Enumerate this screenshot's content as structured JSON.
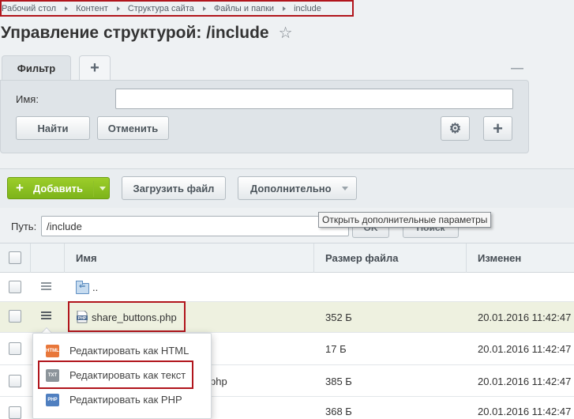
{
  "breadcrumb": [
    "Рабочий стол",
    "Контент",
    "Структура сайта",
    "Файлы и папки",
    "include"
  ],
  "page": {
    "title": "Управление структурой: /include"
  },
  "filter": {
    "tab_label": "Фильтр",
    "name_label": "Имя:",
    "name_value": "",
    "find_label": "Найти",
    "cancel_label": "Отменить"
  },
  "toolbar": {
    "add_label": "Добавить",
    "upload_label": "Загрузить файл",
    "more_label": "Дополнительно",
    "tooltip": "Открыть дополнительные параметры"
  },
  "path": {
    "label": "Путь:",
    "value": "/include",
    "ok_label": "OK",
    "search_label": "Поиск"
  },
  "table": {
    "columns": [
      "Имя",
      "Размер файла",
      "Изменен"
    ],
    "rows": [
      {
        "name": "..",
        "size": "",
        "modified": ""
      },
      {
        "name": "share_buttons.php",
        "size": "352 Б",
        "modified": "20.01.2016 11:42:47"
      },
      {
        "name": "",
        "size": "17 Б",
        "modified": "20.01.2016 11:42:47"
      },
      {
        "name": "php",
        "size": "385 Б",
        "modified": "20.01.2016 11:42:47"
      },
      {
        "name": "",
        "size": "368 Б",
        "modified": "20.01.2016 11:42:47"
      }
    ]
  },
  "context_menu": {
    "items": [
      {
        "label": "Редактировать как HTML",
        "icon": "html-file-icon",
        "tag": "HTML",
        "color": "#e8773a"
      },
      {
        "label": "Редактировать как текст",
        "icon": "txt-file-icon",
        "tag": "TXT",
        "color": "#8c949a"
      },
      {
        "label": "Редактировать как PHP",
        "icon": "php-file-icon",
        "tag": "PHP",
        "color": "#4f7fc0"
      }
    ]
  },
  "colors": {
    "accent_green": "#8bc220",
    "highlight_red": "#b1151c"
  }
}
